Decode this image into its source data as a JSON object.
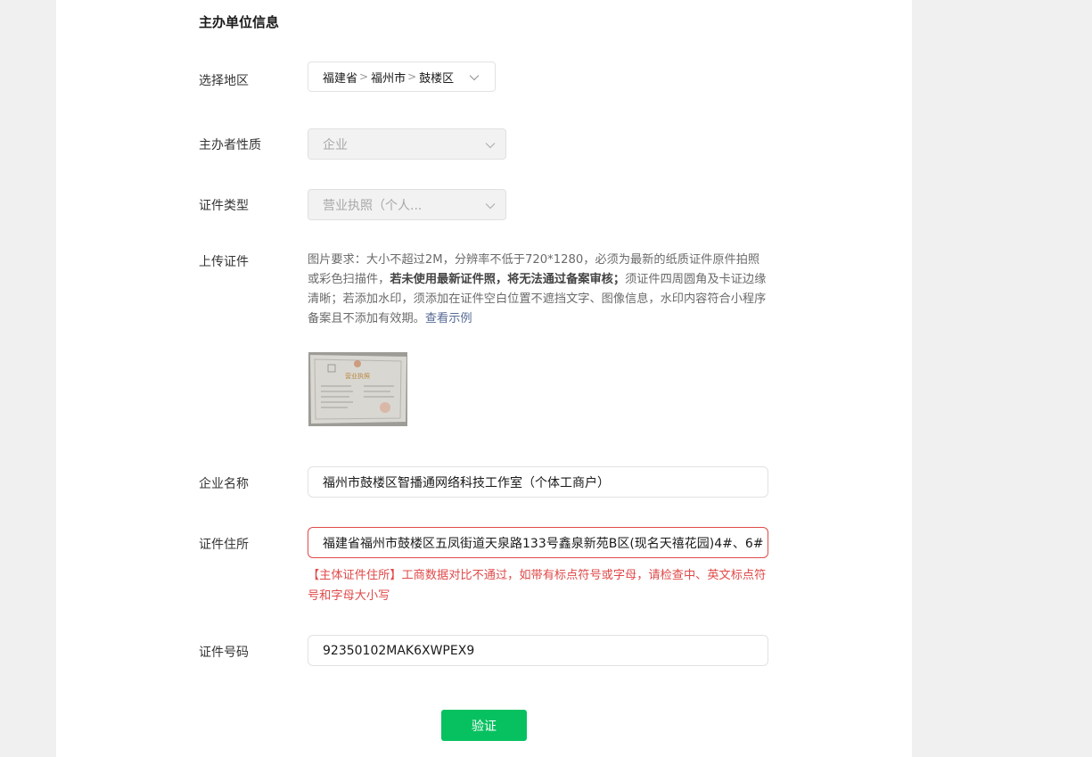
{
  "section_title": "主办单位信息",
  "region": {
    "label": "选择地区",
    "province": "福建省",
    "city": "福州市",
    "district": "鼓楼区",
    "separator": ">"
  },
  "organizer_type": {
    "label": "主办者性质",
    "value": "企业"
  },
  "cert_type": {
    "label": "证件类型",
    "value": "营业执照（个人..."
  },
  "upload": {
    "label": "上传证件",
    "req_part1": "图片要求：大小不超过2M，分辨率不低于720*1280，必须为最新的纸质证件原件拍照或彩色扫描件，",
    "req_bold": "若未使用最新证件照，将无法通过备案审核；",
    "req_part2": "须证件四周圆角及卡证边缘清晰；若添加水印，须添加在证件空白位置不遮挡文字、图像信息，水印内容符合小程序备案且不添加有效期。",
    "example_link": "查看示例",
    "thumb_text": "营业执照"
  },
  "company_name": {
    "label": "企业名称",
    "value": "福州市鼓楼区智播通网络科技工作室（个体工商户）"
  },
  "cert_address": {
    "label": "证件住所",
    "value": "福建省福州市鼓楼区五凤街道天泉路133号鑫泉新苑B区(现名天禧花园)4#、6#",
    "error": "【主体证件住所】工商数据对比不通过，如带有标点符号或字母，请检查中、英文标点符号和字母大小写"
  },
  "cert_number": {
    "label": "证件号码",
    "value": "92350102MAK6XWPEX9"
  },
  "verify_button": "验证",
  "colors": {
    "accent_green": "#07c160",
    "error_red": "#e04a4a",
    "link_blue": "#576b95"
  }
}
